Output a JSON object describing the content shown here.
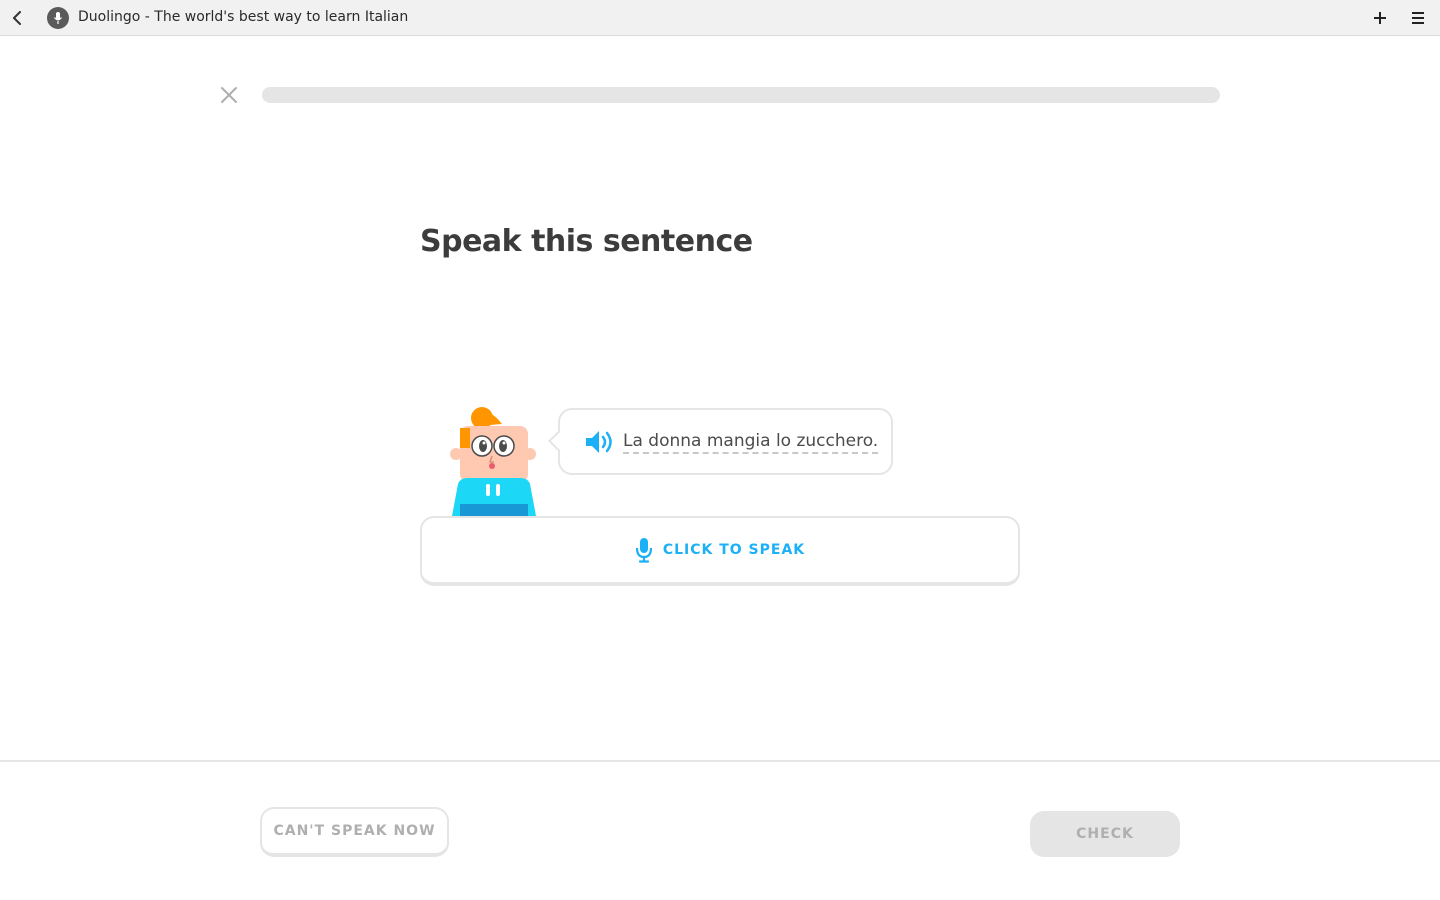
{
  "browser": {
    "tab_title": "Duolingo - The world's best way to learn Italian",
    "icons": {
      "back": "chevron-left-icon",
      "site": "microphone-icon",
      "new_tab": "plus-icon",
      "menu": "hamburger-menu-icon"
    }
  },
  "lesson": {
    "progress": 0,
    "close_icon": "close-icon",
    "prompt_title": "Speak this sentence",
    "sentence": "La donna mangia lo zucchero.",
    "speak_button_label": "CLICK TO SPEAK"
  },
  "footer": {
    "cant_speak_label": "CAN'T SPEAK NOW",
    "check_label": "CHECK"
  },
  "colors": {
    "accent_blue": "#1cb0f6",
    "text_dark": "#3c3c3c",
    "disabled_gray": "#afafaf",
    "border_gray": "#e5e5e5",
    "progress_green": "#58cc02"
  }
}
